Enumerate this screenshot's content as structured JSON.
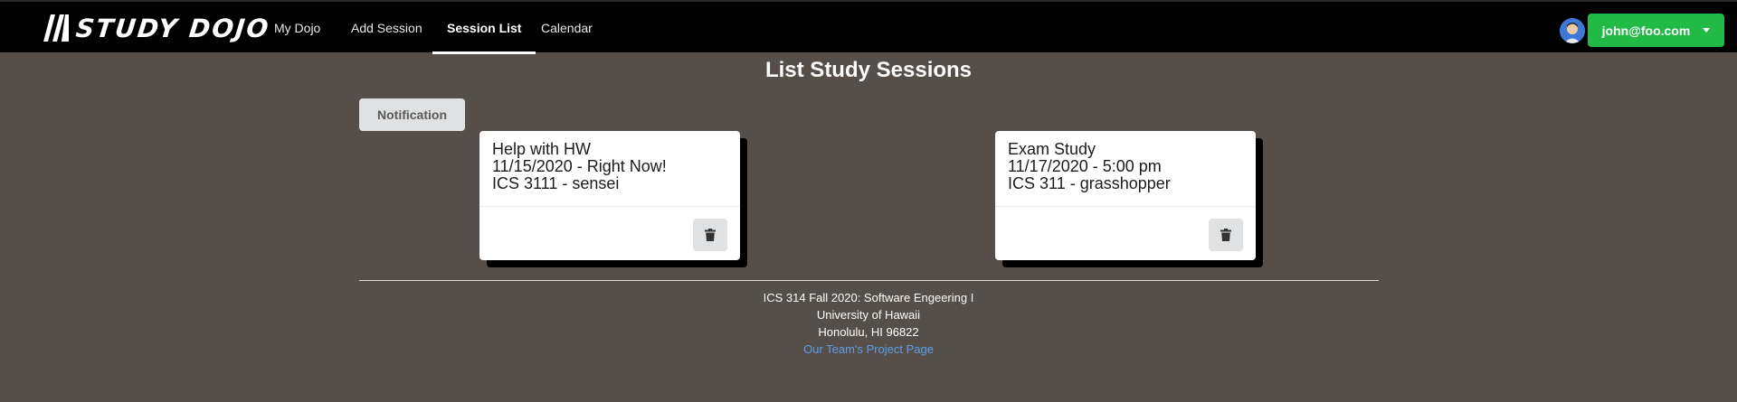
{
  "brand": {
    "name": "STUDY DOJO"
  },
  "nav": {
    "items": [
      {
        "label": "My Dojo",
        "active": false
      },
      {
        "label": "Add Session",
        "active": false
      },
      {
        "label": "Session List",
        "active": true
      },
      {
        "label": "Calendar",
        "active": false
      }
    ]
  },
  "user": {
    "email": "john@foo.com",
    "avatar_icon": "user-avatar-icon",
    "button_color": "#21ba45"
  },
  "page": {
    "title": "List Study Sessions",
    "notification_label": "Notification"
  },
  "sessions": [
    {
      "title": "Help with HW",
      "datetime": "11/15/2020 - Right Now!",
      "course": "ICS 3111 - sensei",
      "action_icon": "trash-icon"
    },
    {
      "title": "Exam Study",
      "datetime": "11/17/2020 - 5:00 pm",
      "course": "ICS 311 - grasshopper",
      "action_icon": "trash-icon"
    }
  ],
  "footer": {
    "line1": "ICS 314 Fall 2020: Software Engeering I",
    "line2": "University of Hawaii",
    "line3": "Honolulu, HI 96822",
    "link_label": "Our Team's Project Page"
  },
  "colors": {
    "background": "#554e49",
    "navbar": "#000000",
    "link": "#5e9ee8"
  }
}
